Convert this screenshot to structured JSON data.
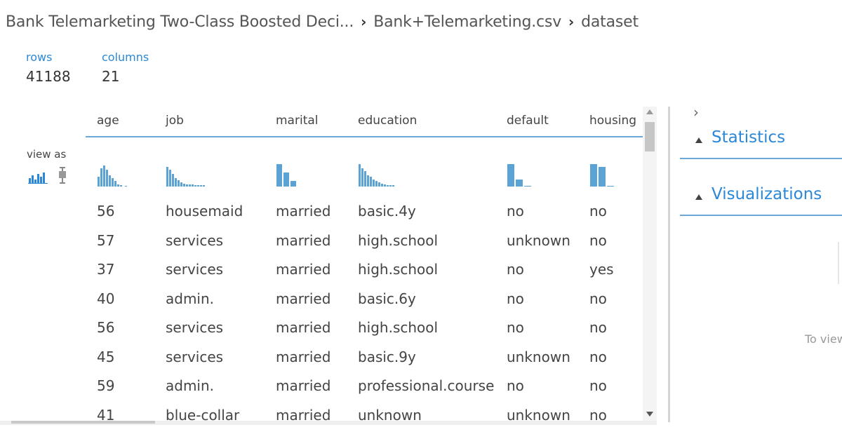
{
  "breadcrumb": {
    "items": [
      "Bank Telemarketing Two-Class Boosted Deci...",
      "Bank+Telemarketing.csv",
      "dataset"
    ]
  },
  "summary": {
    "rows_label": "rows",
    "rows_value": "41188",
    "columns_label": "columns",
    "columns_value": "21"
  },
  "view_as": {
    "label": "view as",
    "icons": [
      "histogram-icon",
      "boxplot-icon"
    ]
  },
  "table": {
    "columns": [
      "age",
      "job",
      "marital",
      "education",
      "default",
      "housing"
    ],
    "rows": [
      [
        "56",
        "housemaid",
        "married",
        "basic.4y",
        "no",
        "no"
      ],
      [
        "57",
        "services",
        "married",
        "high.school",
        "unknown",
        "no"
      ],
      [
        "37",
        "services",
        "married",
        "high.school",
        "no",
        "yes"
      ],
      [
        "40",
        "admin.",
        "married",
        "basic.6y",
        "no",
        "no"
      ],
      [
        "56",
        "services",
        "married",
        "high.school",
        "no",
        "no"
      ],
      [
        "45",
        "services",
        "married",
        "basic.9y",
        "unknown",
        "no"
      ],
      [
        "59",
        "admin.",
        "married",
        "professional.course",
        "no",
        "no"
      ],
      [
        "41",
        "blue-collar",
        "married",
        "unknown",
        "unknown",
        "no"
      ]
    ]
  },
  "panel": {
    "sections": [
      "Statistics",
      "Visualizations"
    ],
    "hint_text": "To view"
  },
  "colors": {
    "accent": "#2b88d8",
    "bar": "#5ba3d5"
  }
}
